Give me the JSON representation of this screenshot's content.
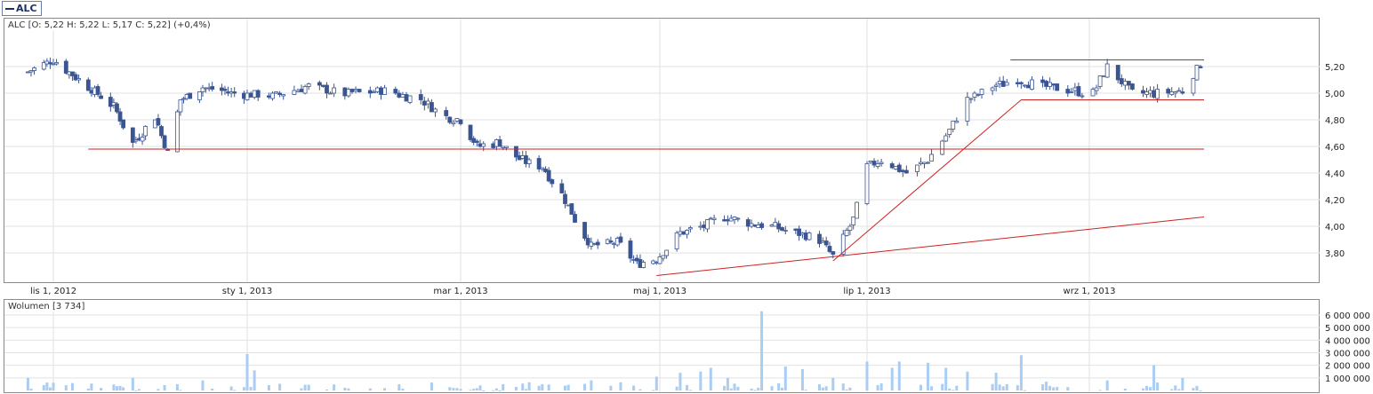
{
  "legend": {
    "ticker": "ALC"
  },
  "price_panel": {
    "ohlc_text": "ALC [O: 5,22  H: 5,22  L: 5,17  C: 5,22] (+0,4%)"
  },
  "volume_panel": {
    "label": "Wolumen [3 734]"
  },
  "colors": {
    "up_candle": "#ffffff",
    "down_candle": "#3b5593",
    "candle_outline": "#3b5593",
    "trendline": "#cc2222",
    "volume_bar": "#a9cdf3",
    "grid": "#e2e2e2",
    "frame": "#8a8a8a"
  },
  "chart_data": [
    {
      "type": "candlestick",
      "title": "ALC",
      "x_tick_labels": [
        "lis 1, 2012",
        "sty 1, 2013",
        "mar 1, 2013",
        "maj 1, 2013",
        "lip 1, 2013",
        "wrz 1, 2013"
      ],
      "y_tick_labels": [
        "3,80",
        "4,00",
        "4,20",
        "4,40",
        "4,60",
        "4,80",
        "5,00",
        "5,20"
      ],
      "ylim": [
        3.59,
        5.52
      ],
      "x_range": [
        "2012-10-23",
        "2013-10-04"
      ],
      "grid": true,
      "last_bar": {
        "open": 5.22,
        "high": 5.22,
        "low": 5.17,
        "close": 5.22,
        "change_pct": 0.4
      },
      "closes_by_date": [
        [
          "2012-10-24",
          5.16
        ],
        [
          "2012-11-01",
          5.25
        ],
        [
          "2012-11-12",
          5.05
        ],
        [
          "2012-11-20",
          4.9
        ],
        [
          "2012-11-26",
          4.62
        ],
        [
          "2012-12-03",
          4.82
        ],
        [
          "2012-12-07",
          4.55
        ],
        [
          "2012-12-11",
          4.95
        ],
        [
          "2012-12-18",
          5.04
        ],
        [
          "2012-12-28",
          5.0
        ],
        [
          "2013-01-08",
          4.98
        ],
        [
          "2013-01-18",
          5.05
        ],
        [
          "2013-01-28",
          5.0
        ],
        [
          "2013-02-08",
          5.02
        ],
        [
          "2013-02-18",
          4.95
        ],
        [
          "2013-02-25",
          4.82
        ],
        [
          "2013-03-01",
          4.8
        ],
        [
          "2013-03-06",
          4.6
        ],
        [
          "2013-03-13",
          4.63
        ],
        [
          "2013-03-19",
          4.5
        ],
        [
          "2013-03-26",
          4.45
        ],
        [
          "2013-04-02",
          4.2
        ],
        [
          "2013-04-05",
          4.05
        ],
        [
          "2013-04-10",
          3.85
        ],
        [
          "2013-04-18",
          3.88
        ],
        [
          "2013-04-24",
          3.72
        ],
        [
          "2013-04-30",
          3.75
        ],
        [
          "2013-05-07",
          3.95
        ],
        [
          "2013-05-14",
          4.0
        ],
        [
          "2013-05-20",
          4.07
        ],
        [
          "2013-05-28",
          4.02
        ],
        [
          "2013-06-03",
          4.0
        ],
        [
          "2013-06-10",
          3.95
        ],
        [
          "2013-06-17",
          3.9
        ],
        [
          "2013-06-21",
          3.78
        ],
        [
          "2013-06-27",
          4.05
        ],
        [
          "2013-07-01",
          4.45
        ],
        [
          "2013-07-05",
          4.5
        ],
        [
          "2013-07-12",
          4.4
        ],
        [
          "2013-07-18",
          4.5
        ],
        [
          "2013-07-24",
          4.72
        ],
        [
          "2013-07-29",
          4.95
        ],
        [
          "2013-08-05",
          5.05
        ],
        [
          "2013-08-12",
          5.1
        ],
        [
          "2013-08-19",
          5.05
        ],
        [
          "2013-08-26",
          5.02
        ],
        [
          "2013-09-02",
          5.0
        ],
        [
          "2013-09-06",
          5.2
        ],
        [
          "2013-09-13",
          5.0
        ],
        [
          "2013-09-20",
          5.0
        ],
        [
          "2013-09-27",
          5.02
        ],
        [
          "2013-10-02",
          5.22
        ]
      ],
      "trendlines": [
        {
          "from": [
            "2012-11-12",
            4.58
          ],
          "to": [
            "2013-10-03",
            4.58
          ]
        },
        {
          "from": [
            "2013-08-10",
            5.25
          ],
          "to": [
            "2013-10-03",
            5.25
          ]
        },
        {
          "from": [
            "2013-08-13",
            4.95
          ],
          "to": [
            "2013-10-03",
            4.95
          ]
        },
        {
          "from": [
            "2013-04-30",
            3.63
          ],
          "to": [
            "2013-10-03",
            4.07
          ]
        },
        {
          "from": [
            "2013-06-21",
            3.74
          ],
          "to": [
            "2013-08-13",
            4.95
          ]
        }
      ]
    },
    {
      "type": "bar",
      "title": "Wolumen",
      "last_value": 3734,
      "y_tick_labels": [
        "1 000 000",
        "2 000 000",
        "3 000 000",
        "4 000 000",
        "5 000 000",
        "6 000 000"
      ],
      "ylim": [
        0,
        6900000
      ],
      "grid": true,
      "volume_by_date": [
        [
          "2012-10-24",
          1000000
        ],
        [
          "2012-11-26",
          1000000
        ],
        [
          "2012-12-18",
          800000
        ],
        [
          "2013-01-01",
          2900000
        ],
        [
          "2013-01-03",
          1600000
        ],
        [
          "2013-03-26",
          500000
        ],
        [
          "2013-04-10",
          800000
        ],
        [
          "2013-04-30",
          1100000
        ],
        [
          "2013-05-07",
          1400000
        ],
        [
          "2013-05-13",
          1500000
        ],
        [
          "2013-05-16",
          1800000
        ],
        [
          "2013-05-21",
          1000000
        ],
        [
          "2013-05-31",
          6300000
        ],
        [
          "2013-06-07",
          1900000
        ],
        [
          "2013-06-12",
          1700000
        ],
        [
          "2013-06-21",
          1000000
        ],
        [
          "2013-07-01",
          2300000
        ],
        [
          "2013-07-08",
          1800000
        ],
        [
          "2013-07-10",
          2300000
        ],
        [
          "2013-07-18",
          2200000
        ],
        [
          "2013-07-23",
          1800000
        ],
        [
          "2013-07-29",
          1500000
        ],
        [
          "2013-08-06",
          1400000
        ],
        [
          "2013-08-13",
          2800000
        ],
        [
          "2013-08-20",
          700000
        ],
        [
          "2013-09-06",
          800000
        ],
        [
          "2013-09-19",
          2000000
        ],
        [
          "2013-09-27",
          1000000
        ],
        [
          "2013-10-02",
          3734
        ]
      ]
    }
  ]
}
